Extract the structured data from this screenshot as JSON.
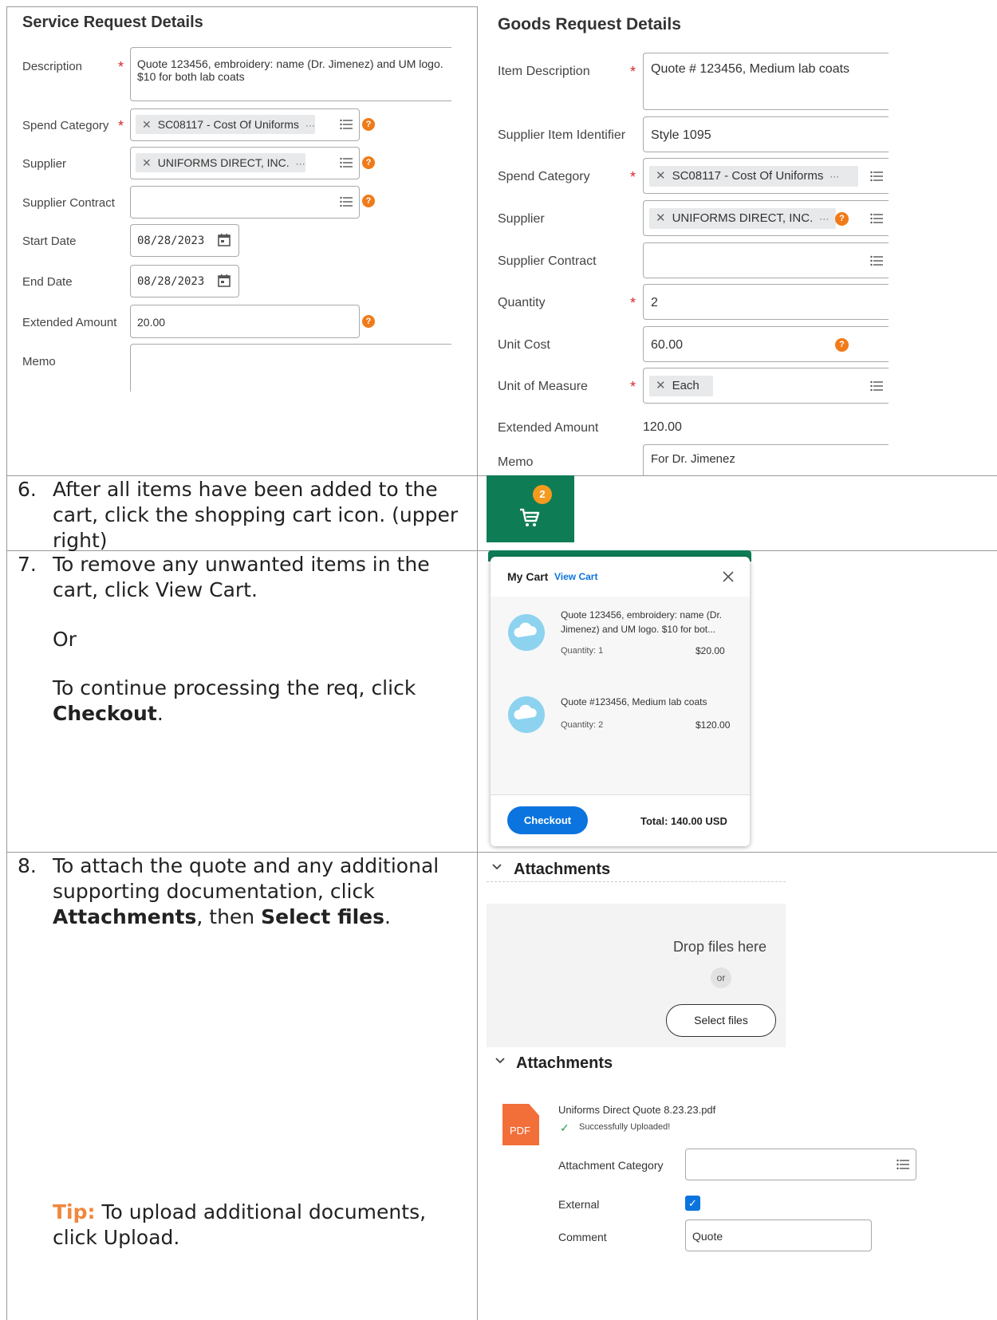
{
  "service": {
    "title": "Service Request Details",
    "description_label": "Description",
    "description_value": "Quote 123456, embroidery: name (Dr. Jimenez) and UM logo. $10 for both lab coats",
    "spend_category_label": "Spend Category",
    "spend_category_value": "SC08117 - Cost Of Uniforms",
    "supplier_label": "Supplier",
    "supplier_value": "UNIFORMS DIRECT, INC.",
    "supplier_contract_label": "Supplier Contract",
    "start_date_label": "Start Date",
    "start_date_value": "08/28/2023",
    "end_date_label": "End Date",
    "end_date_value": "08/28/2023",
    "extended_amount_label": "Extended Amount",
    "extended_amount_value": "20.00",
    "memo_label": "Memo"
  },
  "goods": {
    "title": "Goods Request Details",
    "item_description_label": "Item Description",
    "item_description_value": "Quote # 123456, Medium lab coats",
    "supplier_item_identifier_label": "Supplier Item Identifier",
    "supplier_item_identifier_value": "Style 1095",
    "spend_category_label": "Spend Category",
    "spend_category_value": "SC08117 - Cost Of Uniforms",
    "supplier_label": "Supplier",
    "supplier_value": "UNIFORMS DIRECT, INC.",
    "supplier_contract_label": "Supplier Contract",
    "quantity_label": "Quantity",
    "quantity_value": "2",
    "unit_cost_label": "Unit Cost",
    "unit_cost_value": "60.00",
    "unit_of_measure_label": "Unit of Measure",
    "unit_of_measure_value": "Each",
    "extended_amount_label": "Extended Amount",
    "extended_amount_value": "120.00",
    "memo_label": "Memo",
    "memo_value": "For Dr. Jimenez"
  },
  "steps": {
    "s6": {
      "num": "6.",
      "text": "After all items have been added to the cart, click the shopping cart icon. (upper right)"
    },
    "s7": {
      "num": "7.",
      "line1": "To remove any unwanted items in the cart, click View Cart.",
      "or": "Or",
      "line2": "To continue processing the req, click",
      "line2_bold": "Checkout",
      "line2_end": "."
    },
    "s8": {
      "num": "8.",
      "pre": "To attach the quote and any additional supporting documentation, click",
      "bold1": "Attachments",
      "mid": ", then",
      "bold2": "Select files",
      "end": "."
    },
    "tip_label": "Tip:",
    "tip_text": "To upload additional documents, click Upload."
  },
  "cart_badge": {
    "count": "2"
  },
  "cart": {
    "title": "My Cart",
    "view_cart": "View Cart",
    "items": [
      {
        "name_line1": "Quote 123456, embroidery: name (Dr.",
        "name_line2": "Jimenez) and UM logo. $10 for bot...",
        "quantity": "Quantity: 1",
        "price": "$20.00"
      },
      {
        "name_line1": "Quote #123456, Medium lab coats",
        "quantity": "Quantity: 2",
        "price": "$120.00"
      }
    ],
    "checkout": "Checkout",
    "total": "Total: 140.00 USD"
  },
  "attachments_panel": {
    "title": "Attachments",
    "drop_text": "Drop files here",
    "or": "or",
    "select_files": "Select files"
  },
  "attachments_uploaded": {
    "title": "Attachments",
    "filename": "Uniforms Direct Quote 8.23.23.pdf",
    "status": "Successfully Uploaded!",
    "pdf_label": "PDF",
    "attachment_category_label": "Attachment Category",
    "external_label": "External",
    "external_checked": true,
    "comment_label": "Comment",
    "comment_value": "Quote"
  },
  "colors": {
    "required": "#d9262a",
    "help": "#f07b1a",
    "cart_green": "#0e7c55",
    "primary_blue": "#0b74de",
    "pdf_orange": "#f26f3a",
    "link_blue": "#0b74de"
  }
}
